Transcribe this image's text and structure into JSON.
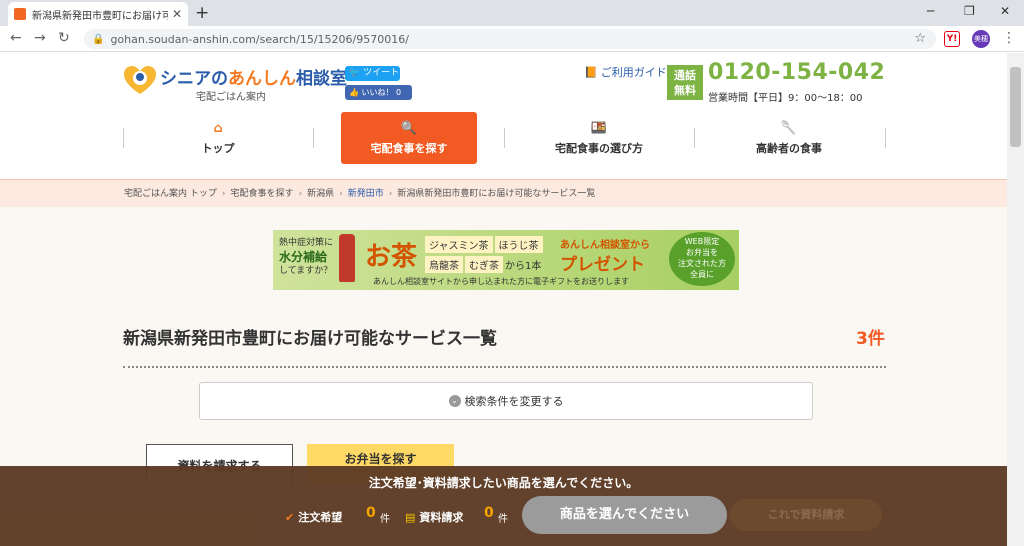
{
  "browser": {
    "tab_title": "新潟県新発田市豊町にお届け可能",
    "new_tab": "+",
    "url": "gohan.soudan-anshin.com/search/15/15206/9570016/",
    "ext_label": "Y!",
    "profile_label": "美穂"
  },
  "header": {
    "logo_blue": "シニアの",
    "logo_orange": "あんしん",
    "logo_blue2": "相談室",
    "logo_sub": "宅配ごはん案内",
    "tweet": "ツイート",
    "like": "いいね！ 0",
    "guide": "ご利用ガイド",
    "free_line1": "通話",
    "free_line2": "無料",
    "phone": "0120-154-042",
    "hours": "営業時間【平日】9：00～18：00"
  },
  "nav": {
    "items": [
      {
        "label": "トップ",
        "icon": "home-icon"
      },
      {
        "label": "宅配食事を探す",
        "icon": "search-icon"
      },
      {
        "label": "宅配食事の選び方",
        "icon": "bento-icon"
      },
      {
        "label": "高齢者の食事",
        "icon": "spoon-icon"
      }
    ]
  },
  "breadcrumb": {
    "items": [
      "宅配ごはん案内 トップ",
      "宅配食事を探す",
      "新潟県",
      "新発田市",
      "新潟県新発田市豊町にお届け可能なサービス一覧"
    ]
  },
  "banner": {
    "left1": "熱中症対策に",
    "left2": "水分補給",
    "left3": "してますか？",
    "ocha": "お茶",
    "tag1": "ジャスミン茶",
    "tag2": "ほうじ茶",
    "tag3": "烏龍茶",
    "tag4": "むぎ茶",
    "tag_from": "から1本",
    "from": "あんしん相談室から",
    "present": "プレゼント",
    "web1": "WEB限定",
    "web2": "お弁当を",
    "web3": "注文された方",
    "web4": "全員に",
    "note": "あんしん相談室サイトから申し込まれた方に電子ギフトをお送りします"
  },
  "main": {
    "title": "新潟県新発田市豊町にお届け可能なサービス一覧",
    "count": "3件",
    "search_toggle": "検索条件を変更する",
    "tab_doc": "資料を請求する",
    "tab_bento": "お弁当を探す"
  },
  "bottom": {
    "message": "注文希望･資料請求したい商品を選んでください。",
    "order_label": "注文希望",
    "order_count": "0",
    "doc_label": "資料請求",
    "doc_count": "0",
    "unit": "件",
    "select_button": "商品を選んでください",
    "ghost_button": "これで資料請求"
  },
  "colors": {
    "accent": "#f15a22",
    "green": "#7cb342",
    "bar": "#5c3a23"
  }
}
